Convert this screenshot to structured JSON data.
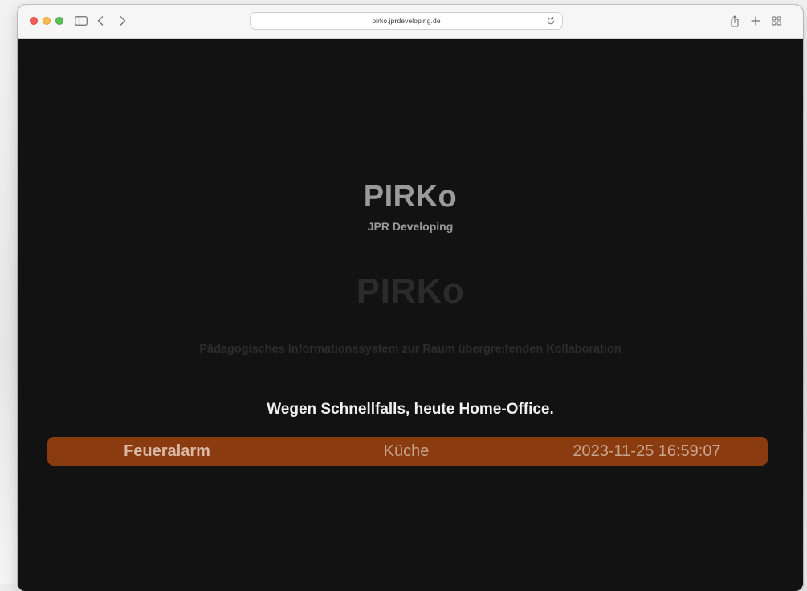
{
  "browser": {
    "url": "pirko.jprdeveloping.de",
    "icons": {
      "sidebar": "sidebar-icon",
      "back": "chevron-left-icon",
      "forward": "chevron-right-icon",
      "reload": "reload-icon",
      "share": "share-icon",
      "new_tab": "plus-icon",
      "tab_overview": "grid-icon"
    }
  },
  "page": {
    "title": "PIRKo",
    "subtitle": "JPR Developing",
    "ghost_title": "PIRKo",
    "tagline": "Pädagogisches Informationssystem zur Raum übergreifenden Kollaboration",
    "notice": "Wegen Schnellfalls, heute Home-Office."
  },
  "alarm": {
    "type": "Feueralarm",
    "room": "Küche",
    "timestamp": "2023-11-25 16:59:07",
    "color": "#8a3c10"
  },
  "colors": {
    "background": "#121212",
    "title_text": "#9a9a9a",
    "notice_text": "#f0f0f0"
  }
}
